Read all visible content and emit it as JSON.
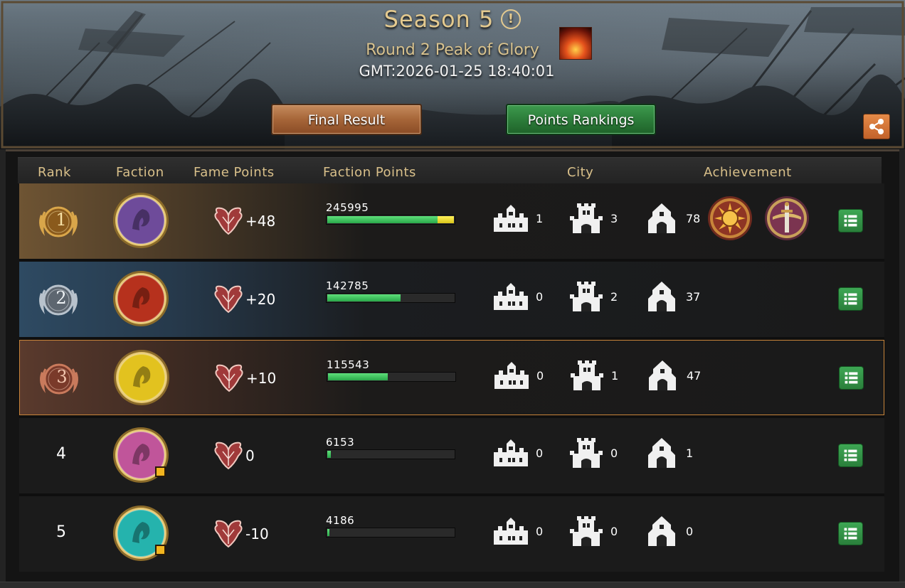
{
  "header": {
    "season_title": "Season 5",
    "info_glyph": "!",
    "round_title": "Round 2 Peak of Glory",
    "gmt": "GMT:2026-01-25 18:40:01",
    "final_result_label": "Final Result",
    "points_rankings_label": "Points Rankings"
  },
  "columns": {
    "rank": "Rank",
    "faction": "Faction",
    "fame_points": "Fame Points",
    "faction_points": "Faction Points",
    "city": "City",
    "achievement": "Achievement"
  },
  "rows": [
    {
      "rank": "1",
      "faction_icon": "dragon-sigil-icon",
      "faction_color": "#6e4b9a",
      "fame": "+48",
      "faction_points": "245995",
      "progress_green": 0.87,
      "progress_yellow": 0.13,
      "city_small": "1",
      "city_medium": "3",
      "city_large": "78",
      "achievements": [
        "sun-crest-achievement-icon",
        "sword-crest-achievement-icon"
      ]
    },
    {
      "rank": "2",
      "faction_icon": "lion-sigil-icon",
      "faction_color": "#b6311d",
      "fame": "+20",
      "faction_points": "142785",
      "progress_green": 0.58,
      "progress_yellow": 0,
      "city_small": "0",
      "city_medium": "2",
      "city_large": "37",
      "achievements": []
    },
    {
      "rank": "3",
      "faction_icon": "wolf-sigil-icon",
      "faction_color": "#e2c21f",
      "fame": "+10",
      "faction_points": "115543",
      "progress_green": 0.47,
      "progress_yellow": 0,
      "city_small": "0",
      "city_medium": "1",
      "city_large": "47",
      "achievements": []
    },
    {
      "rank": "4",
      "faction_icon": "stag-sigil-icon",
      "faction_color": "#c0559a",
      "fame": "0",
      "faction_points": "6153",
      "progress_green": 0.03,
      "progress_yellow": 0,
      "city_small": "0",
      "city_medium": "0",
      "city_large": "1",
      "achievements": []
    },
    {
      "rank": "5",
      "faction_icon": "kraken-sigil-icon",
      "faction_color": "#25b3ad",
      "fame": "-10",
      "faction_points": "4186",
      "progress_green": 0.015,
      "progress_yellow": 0,
      "city_small": "0",
      "city_medium": "0",
      "city_large": "0",
      "achievements": []
    }
  ]
}
